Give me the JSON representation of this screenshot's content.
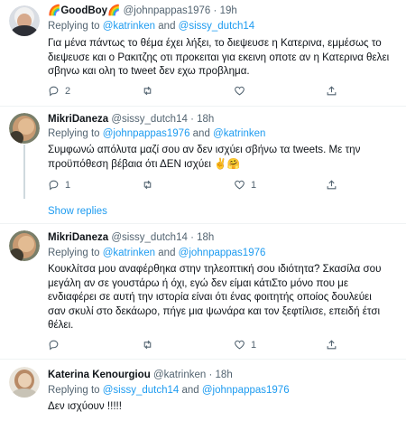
{
  "tweets": [
    {
      "name": "🌈GoodBoy🌈",
      "handle": "@johnpappas1976",
      "dot": "·",
      "time": "19h",
      "replying_prefix": "Replying to ",
      "mention1": "@katrinken",
      "and": " and ",
      "mention2": "@sissy_dutch14",
      "text": "Για μένα πάντως το θέμα έχει λήξει, το διεψευσε η Κατερινα, εμμέσως το διεψευσε και ο Ρακιτζης οτι προκειται για εκεινη οποτε αν η Κατερινα θελει σβηνω και ολη το tweet  δεν εχω προβλημα.",
      "reply_count": "2",
      "retweet_count": "",
      "like_count": ""
    },
    {
      "name": "MikriDaneza",
      "handle": "@sissy_dutch14",
      "dot": "·",
      "time": "18h",
      "replying_prefix": "Replying to ",
      "mention1": "@johnpappas1976",
      "and": " and ",
      "mention2": "@katrinken",
      "text": "Συμφωνώ απόλυτα μαζί σου αν δεν ισχύει σβήνω τα tweets. Με την προϋπόθεση βέβαια ότι ΔΕΝ ισχύει ✌️🤗",
      "reply_count": "1",
      "retweet_count": "",
      "like_count": "1"
    },
    {
      "name": "MikriDaneza",
      "handle": "@sissy_dutch14",
      "dot": "·",
      "time": "18h",
      "replying_prefix": "Replying to ",
      "mention1": "@katrinken",
      "and": " and ",
      "mention2": "@johnpappas1976",
      "text": "Κουκλίτσα μου αναφέρθηκα στην τηλεοπτική σου ιδιότητα? Σκασίλα σου μεγάλη αν σε γουστάρω ή όχι, εγώ δεν είμαι κάτιΣτο μόνο που με ενδιαφέρει σε αυτή την ιστορία είναι ότι ένας φοιτητής οποίος δουλεύει σαν σκυλί στο δεκάωρο, πήγε μια ψωνάρα και τον ξεφτίλισε, επειδή έτσι θέλει.",
      "reply_count": "",
      "retweet_count": "",
      "like_count": "1"
    },
    {
      "name": "Katerina Kenourgiou",
      "handle": "@katrinken",
      "dot": "·",
      "time": "18h",
      "replying_prefix": "Replying to ",
      "mention1": "@sissy_dutch14",
      "and": " and ",
      "mention2": "@johnpappas1976",
      "text": "Δεν ισχύουν !!!!!"
    }
  ],
  "show_replies": "Show replies",
  "icons": {
    "reply": "reply-icon",
    "retweet": "retweet-icon",
    "like": "heart-icon",
    "share": "share-icon"
  },
  "colors": {
    "mention": "#1d9bf0",
    "secondary_text": "#536471",
    "divider": "#eff3f4",
    "thread_line": "#cfd9de"
  }
}
